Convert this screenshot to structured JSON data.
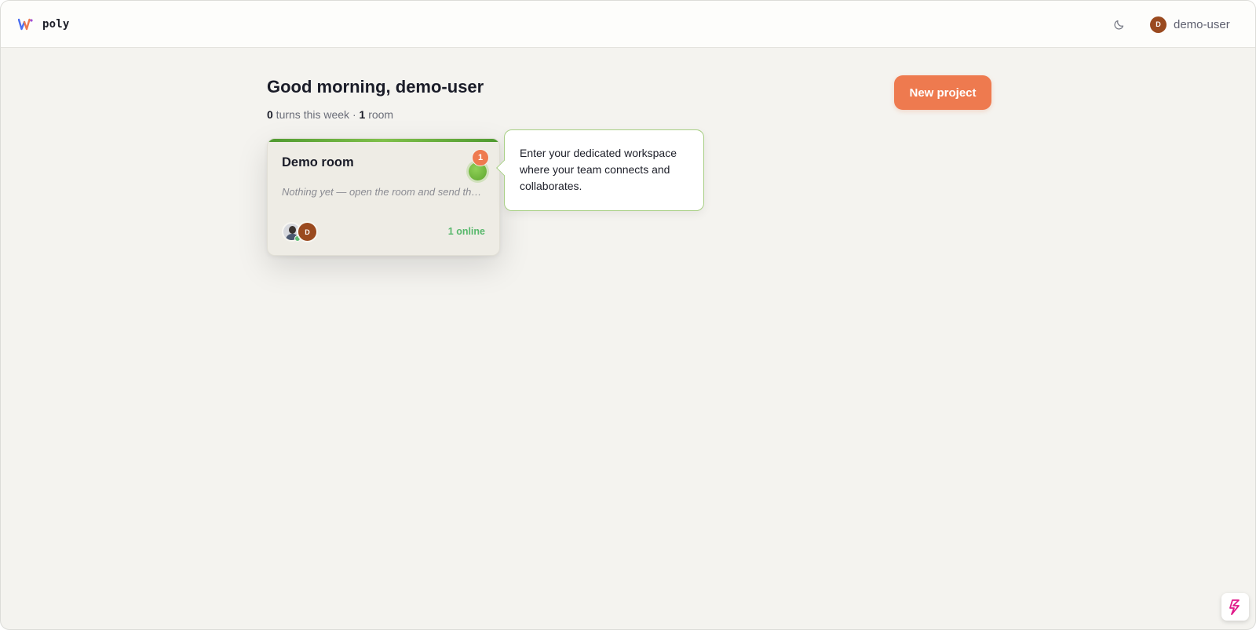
{
  "header": {
    "brand_name": "poly",
    "brand_logo_icon": "poly-logo-icon",
    "theme_toggle_icon": "moon-icon",
    "user": {
      "initial": "D",
      "name": "demo-user",
      "avatar_color": "#9a4a1f"
    }
  },
  "main": {
    "greeting": "Good morning, demo-user",
    "stats": {
      "turns_count": "0",
      "turns_label": " turns this week",
      "separator": " · ",
      "rooms_count": "1",
      "rooms_label": " room"
    },
    "new_project_label": "New project",
    "accent_color": "#ee7a4f"
  },
  "room_card": {
    "title": "Demo room",
    "preview": "Nothing yet — open the room and send the first message",
    "members": [
      {
        "kind": "photo",
        "icon": "user-photo-avatar",
        "online": true
      },
      {
        "kind": "initial",
        "initial": "D",
        "color": "#9a4a1f"
      }
    ],
    "online_label": "1 online",
    "accent_color": "#6cb03c"
  },
  "onboarding": {
    "step_badge": "1",
    "tooltip_text": "Enter your dedicated workspace where your team connects and collaborates."
  },
  "corner_widget": {
    "icon": "lightning-widget-icon"
  }
}
